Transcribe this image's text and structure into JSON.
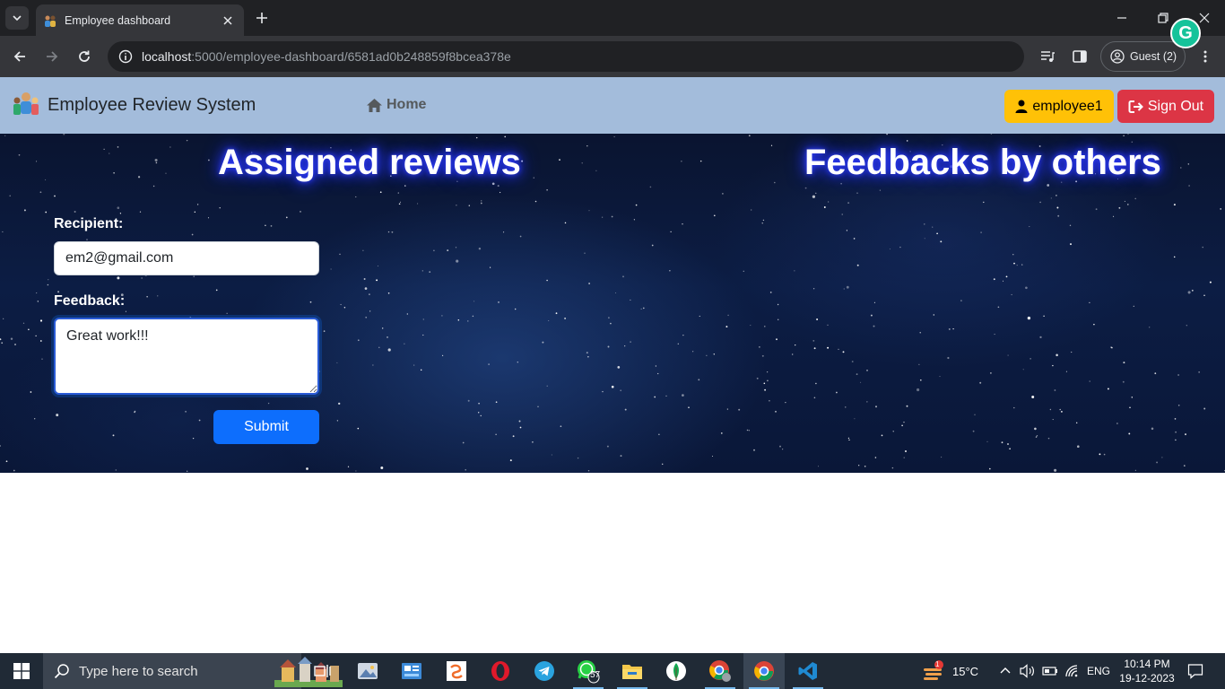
{
  "browser": {
    "tab_title": "Employee dashboard",
    "url_host": "localhost",
    "url_path": ":5000/employee-dashboard/6581ad0b248859f8bcea378e",
    "profile_label": "Guest (2)",
    "grammarly_letter": "G"
  },
  "navbar": {
    "brand": "Employee Review System",
    "home_label": "Home",
    "user_label": "employee1",
    "signout_label": "Sign Out"
  },
  "main": {
    "assigned_heading": "Assigned reviews",
    "feedback_heading": "Feedbacks by others",
    "form": {
      "recipient_label": "Recipient:",
      "recipient_value": "em2@gmail.com",
      "feedback_label": "Feedback:",
      "feedback_value": "Great work!!!",
      "submit_label": "Submit"
    }
  },
  "taskbar": {
    "search_placeholder": "Type here to search",
    "whatsapp_badge": "57",
    "weather_badge": "1",
    "temperature": "15°C",
    "language": "ENG",
    "time": "10:14 PM",
    "date": "19-12-2023"
  },
  "colors": {
    "navbar_bg": "#a3bcdb",
    "user_button": "#ffc107",
    "signout_button": "#dc3545",
    "submit_button": "#0d6efd",
    "heading_glow": "#2f3cff"
  }
}
